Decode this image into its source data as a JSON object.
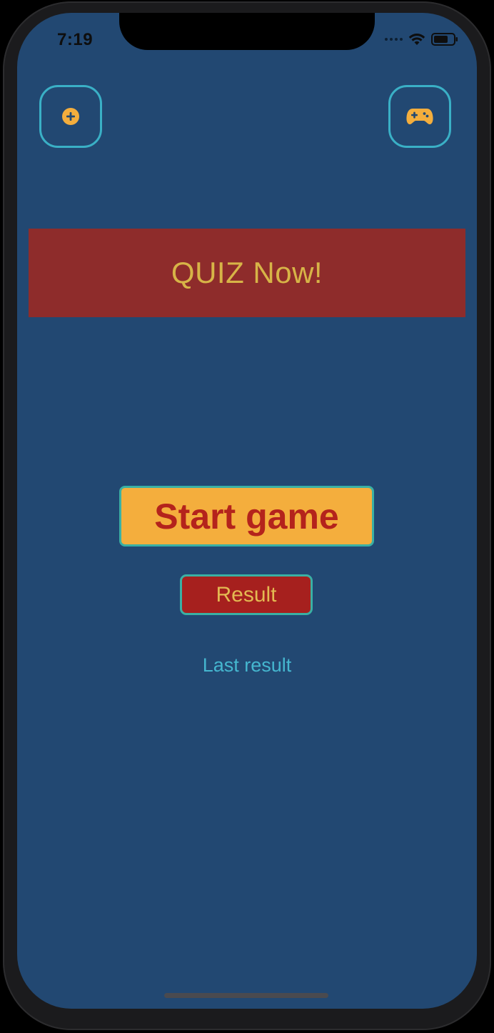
{
  "status_bar": {
    "time": "7:19",
    "wifi_icon": "wifi-icon",
    "battery_icon": "battery-icon"
  },
  "toolbar": {
    "add_icon": "plus-circle-icon",
    "game_icon": "gamepad-icon"
  },
  "banner": {
    "title": "QUIZ Now!"
  },
  "actions": {
    "start_label": "Start game",
    "result_label": "Result",
    "last_result_label": "Last result"
  },
  "colors": {
    "background": "#224872",
    "banner": "#8e2c2b",
    "banner_text": "#d7b447",
    "start_button": "#f4ae3d",
    "start_text": "#b4231c",
    "result_button": "#a6201e",
    "result_text": "#e3b952",
    "accent_border": "#3ab0c6",
    "link": "#45b6cf",
    "icon": "#f4ae3d"
  }
}
